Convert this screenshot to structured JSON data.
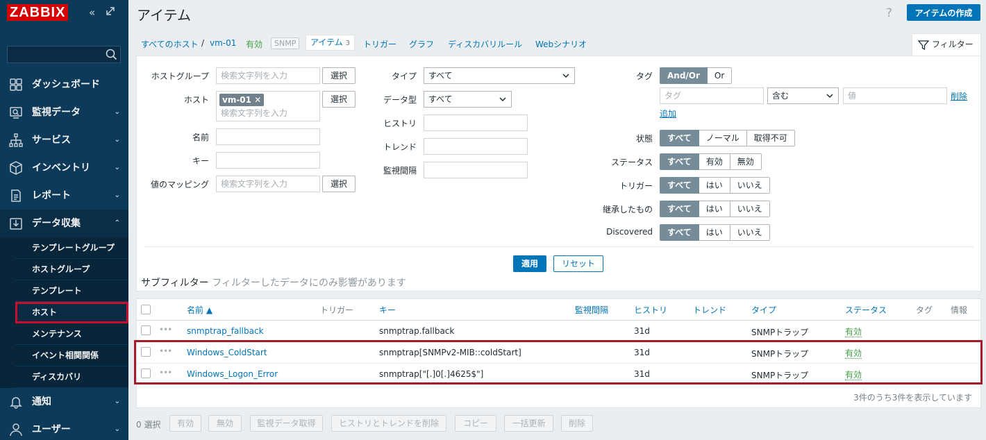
{
  "app": {
    "logo": "ZABBIX"
  },
  "sidebar": {
    "search_value": "",
    "items": [
      {
        "label": "ダッシュボード",
        "icon": "dashboard-icon",
        "chevron": ""
      },
      {
        "label": "監視データ",
        "icon": "monitoring-icon",
        "chevron": "⌄"
      },
      {
        "label": "サービス",
        "icon": "services-icon",
        "chevron": "⌄"
      },
      {
        "label": "インベントリ",
        "icon": "inventory-icon",
        "chevron": "⌄"
      },
      {
        "label": "レポート",
        "icon": "reports-icon",
        "chevron": "⌄"
      },
      {
        "label": "データ収集",
        "icon": "data-collection-icon",
        "chevron": "⌃"
      },
      {
        "label": "通知",
        "icon": "alerts-icon",
        "chevron": "⌄"
      },
      {
        "label": "ユーザー",
        "icon": "users-icon",
        "chevron": "⌄"
      }
    ],
    "subitems": [
      "テンプレートグループ",
      "ホストグループ",
      "テンプレート",
      "ホスト",
      "メンテナンス",
      "イベント相関関係",
      "ディスカバリ"
    ]
  },
  "header": {
    "title": "アイテム",
    "help": "?",
    "create_button": "アイテムの作成"
  },
  "breadcrumb": {
    "all_hosts": "すべてのホスト",
    "sep": "/",
    "host": "vm-01",
    "status": "有効",
    "snmp": "SNMP",
    "items_tab": "アイテム",
    "items_count": "3",
    "triggers": "トリガー",
    "graphs": "グラフ",
    "discovery": "ディスカバリルール",
    "web": "Webシナリオ"
  },
  "filter_tab": "フィルター",
  "filter": {
    "hostgroup_label": "ホストグループ",
    "host_label": "ホスト",
    "name_label": "名前",
    "key_label": "キー",
    "valuemap_label": "値のマッピング",
    "search_placeholder": "検索文字列を入力",
    "select_button": "選択",
    "host_token": "vm-01",
    "type_label": "タイプ",
    "type_value": "すべて",
    "datatype_label": "データ型",
    "datatype_value": "すべて",
    "history_label": "ヒストリ",
    "trends_label": "トレンド",
    "interval_label": "監視間隔",
    "tag_label": "タグ",
    "tag_andor": "And/Or",
    "tag_or": "Or",
    "tag_placeholder": "タグ",
    "tag_op": "含む",
    "tag_value_placeholder": "値",
    "tag_remove": "削除",
    "tag_add": "追加",
    "state_label": "状態",
    "state_opts": [
      "すべて",
      "ノーマル",
      "取得不可"
    ],
    "status_label": "ステータス",
    "status_opts": [
      "すべて",
      "有効",
      "無効"
    ],
    "triggers_label": "トリガー",
    "inherited_label": "継承したもの",
    "discovered_label": "Discovered",
    "yesno_opts": [
      "すべて",
      "はい",
      "いいえ"
    ],
    "apply": "適用",
    "reset": "リセット",
    "subfilter": "サブフィルター",
    "subfilter_hint": "フィルターしたデータにのみ影響があります"
  },
  "table": {
    "columns": {
      "name": "名前 ▲",
      "triggers": "トリガー",
      "key": "キー",
      "interval": "監視間隔",
      "history": "ヒストリ",
      "trends": "トレンド",
      "type": "タイプ",
      "status": "ステータス",
      "tags": "タグ",
      "info": "情報"
    },
    "rows": [
      {
        "name": "snmptrap_fallback",
        "key": "snmptrap.fallback",
        "history": "31d",
        "type": "SNMPトラップ",
        "status": "有効"
      },
      {
        "name": "Windows_ColdStart",
        "key": "snmptrap[SNMPv2-MIB::coldStart]",
        "history": "31d",
        "type": "SNMPトラップ",
        "status": "有効"
      },
      {
        "name": "Windows_Logon_Error",
        "key": "snmptrap[\"[.]0[.]4625$\"]",
        "history": "31d",
        "type": "SNMPトラップ",
        "status": "有効"
      }
    ],
    "footer": "3件のうち3件を表示しています"
  },
  "actions": {
    "selected": "0 選択",
    "buttons": [
      "有効",
      "無効",
      "監視データ取得",
      "ヒストリとトレンドを削除",
      "コピー",
      "一括更新",
      "削除"
    ]
  },
  "colors": {
    "sidebar": "#0e3a5a",
    "accent": "#0275b8",
    "logo": "#d40000",
    "highlight": "#a51c2c",
    "enabled": "#429e47"
  }
}
